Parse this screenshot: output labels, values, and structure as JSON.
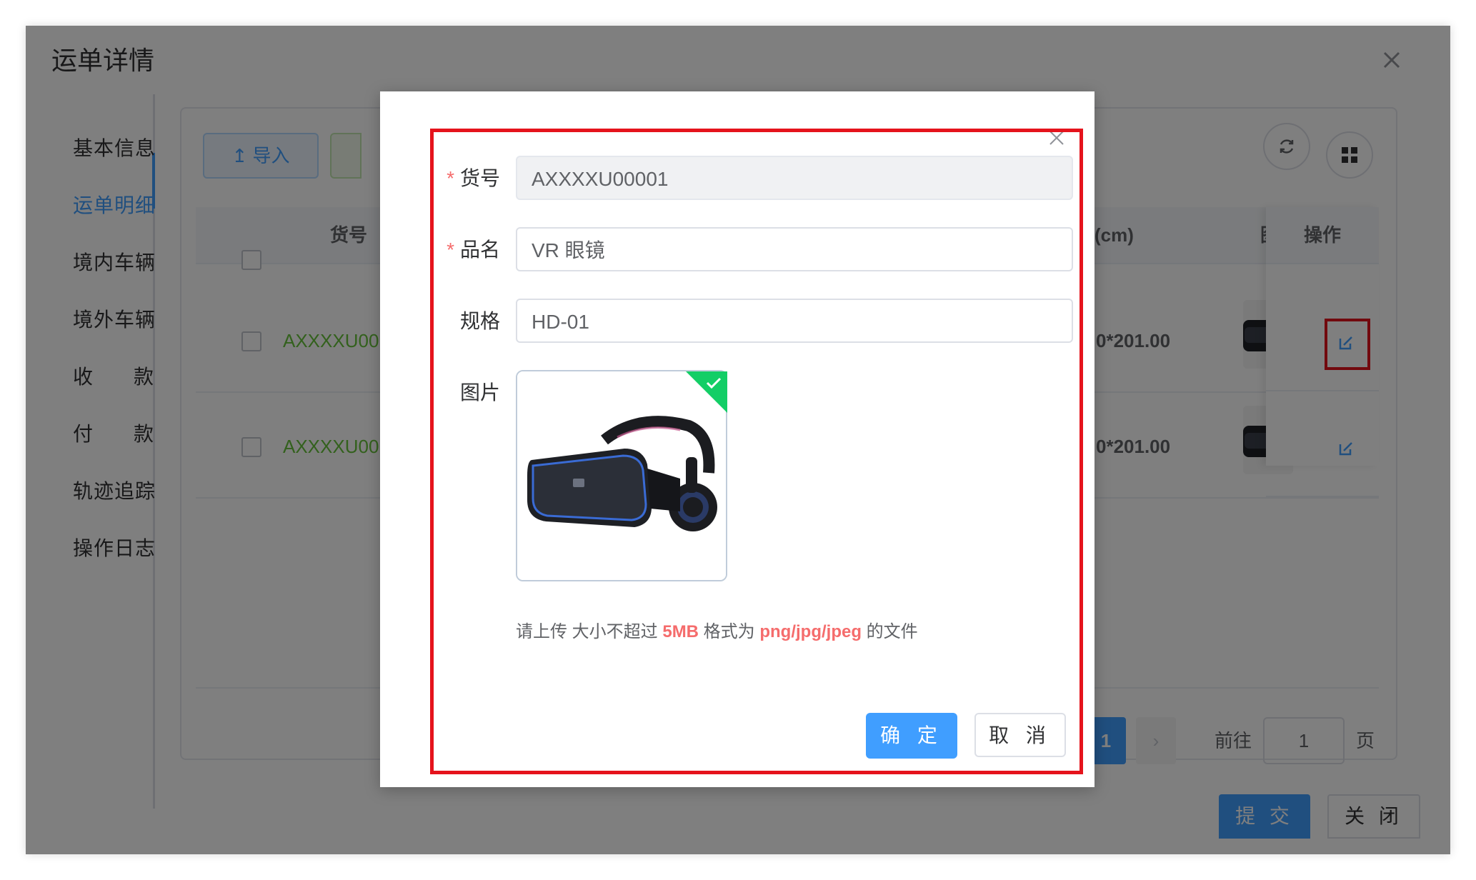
{
  "window": {
    "title": "运单详情"
  },
  "sidebar": {
    "items": [
      {
        "label": "基本信息"
      },
      {
        "label": "运单明细",
        "active": true
      },
      {
        "label": "境内车辆"
      },
      {
        "label": "境外车辆"
      },
      {
        "label_a": "收",
        "label_b": "款"
      },
      {
        "label_a": "付",
        "label_b": "款"
      },
      {
        "label": "轨迹追踪"
      },
      {
        "label": "操作日志"
      }
    ]
  },
  "toolbar": {
    "import_label": "↥ 导入"
  },
  "table": {
    "headers": {
      "goods_no": "货号",
      "size": "(cm)",
      "image": "图片",
      "actions": "操作"
    },
    "rows": [
      {
        "goods_no": "AXXXXU00",
        "size": "0*201.00"
      },
      {
        "goods_no": "AXXXXU00",
        "size": "0*201.00"
      }
    ]
  },
  "pagination": {
    "current_page": "1",
    "next": "›",
    "goto_label": "前往",
    "goto_value": "1",
    "goto_suffix": "页"
  },
  "footer": {
    "submit_label": "提 交",
    "close_label": "关 闭"
  },
  "modal": {
    "fields": {
      "goods_no": {
        "label": "货号",
        "required": "*",
        "value": "AXXXXU00001"
      },
      "name": {
        "label": "品名",
        "required": "*",
        "value": "VR 眼镜"
      },
      "spec": {
        "label": "规格",
        "value": "HD-01"
      },
      "image": {
        "label": "图片"
      }
    },
    "upload_tip": {
      "prefix": "请上传 大小不超过 ",
      "size": "5MB",
      "middle": " 格式为 ",
      "formats": "png/jpg/jpeg",
      "suffix": " 的文件"
    },
    "confirm_label": "确 定",
    "cancel_label": "取 消"
  },
  "colors": {
    "primary": "#409eff",
    "success": "#67c23a",
    "danger": "#f56c6c",
    "highlight": "#e5131c"
  }
}
